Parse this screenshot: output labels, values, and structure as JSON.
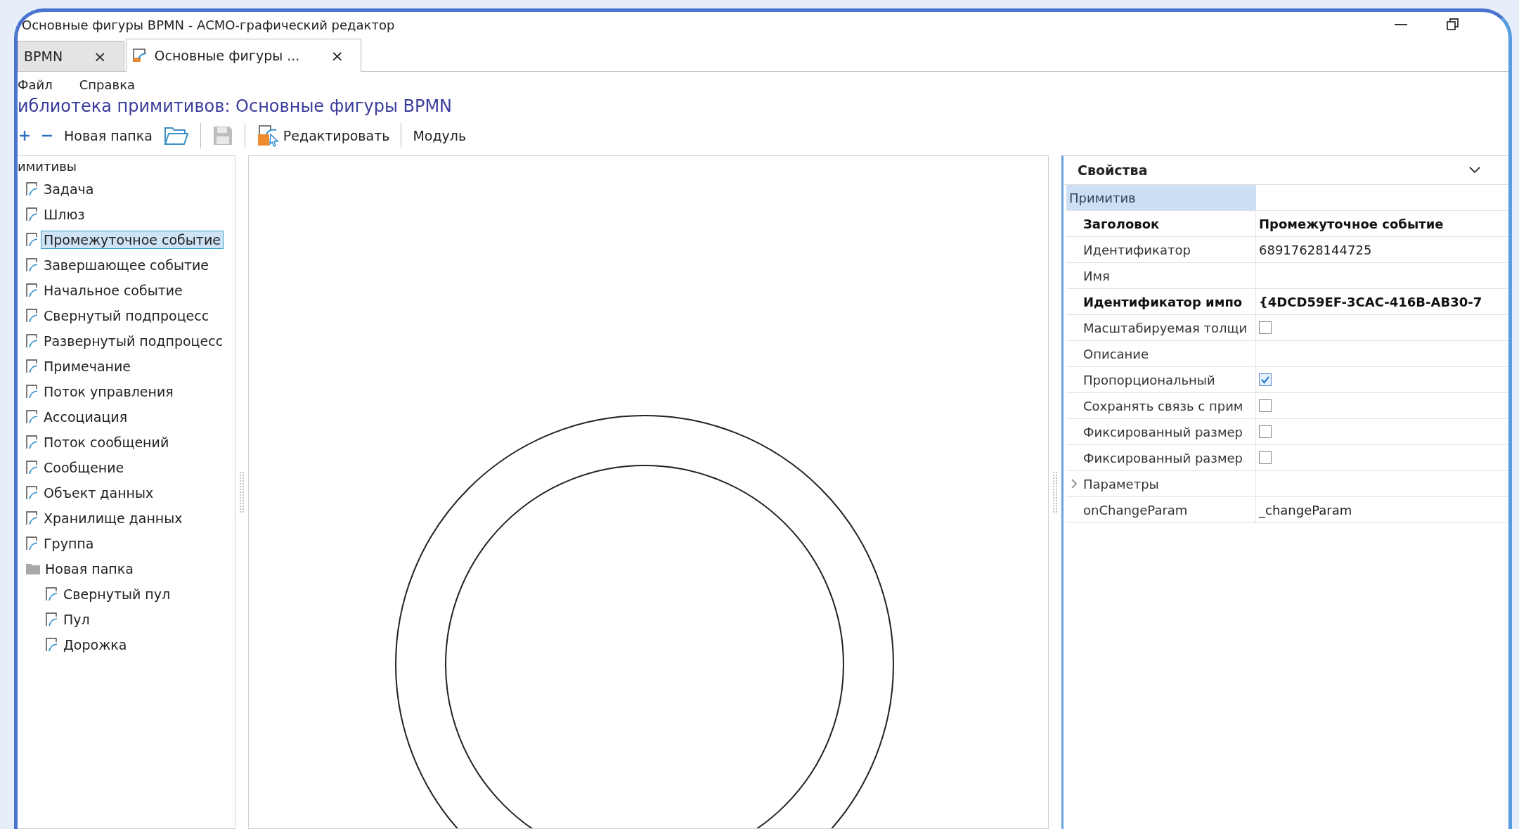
{
  "window": {
    "title": "Основные фигуры BPMN - АСМО-графический редактор"
  },
  "tabs": [
    {
      "label": "BPMN",
      "close": "×",
      "selected": false
    },
    {
      "label": "Основные фигуры ...",
      "close": "×",
      "selected": true
    }
  ],
  "menu": [
    "Файл",
    "Справка"
  ],
  "library_title": "иблиотека примитивов: Основные фигуры BPMN",
  "toolbar": {
    "new_folder": "Новая папка",
    "edit": "Редактировать",
    "module": "Модуль"
  },
  "tree": {
    "header": "имитивы",
    "items": [
      {
        "label": "Задача",
        "kind": "primitive",
        "selected": false
      },
      {
        "label": "Шлюз",
        "kind": "primitive",
        "selected": false
      },
      {
        "label": "Промежуточное событие",
        "kind": "primitive",
        "selected": true
      },
      {
        "label": "Завершающее событие",
        "kind": "primitive",
        "selected": false
      },
      {
        "label": "Начальное событие",
        "kind": "primitive",
        "selected": false
      },
      {
        "label": "Свернутый подпроцесс",
        "kind": "primitive",
        "selected": false
      },
      {
        "label": "Развернутый подпроцесс",
        "kind": "primitive",
        "selected": false
      },
      {
        "label": "Примечание",
        "kind": "primitive",
        "selected": false
      },
      {
        "label": "Поток управления",
        "kind": "primitive",
        "selected": false
      },
      {
        "label": "Ассоциация",
        "kind": "primitive",
        "selected": false
      },
      {
        "label": "Поток сообщений",
        "kind": "primitive",
        "selected": false
      },
      {
        "label": "Сообщение",
        "kind": "primitive",
        "selected": false
      },
      {
        "label": "Объект данных",
        "kind": "primitive",
        "selected": false
      },
      {
        "label": "Хранилище данных",
        "kind": "primitive",
        "selected": false
      },
      {
        "label": "Группа",
        "kind": "primitive",
        "selected": false
      },
      {
        "label": "Новая папка",
        "kind": "folder",
        "selected": false,
        "children": [
          {
            "label": "Свернутый пул",
            "kind": "primitive",
            "selected": false
          },
          {
            "label": "Пул",
            "kind": "primitive",
            "selected": false
          },
          {
            "label": "Дорожка",
            "kind": "primitive",
            "selected": false
          }
        ]
      }
    ]
  },
  "properties": {
    "title": "Свойства",
    "category": "Примитив",
    "rows": [
      {
        "name": "Заголовок",
        "kind": "text",
        "bold": true,
        "value": "Промежуточное событие"
      },
      {
        "name": "Идентификатор",
        "kind": "text",
        "bold": false,
        "value": "68917628144725"
      },
      {
        "name": "Имя",
        "kind": "text",
        "bold": false
      },
      {
        "name": "Идентификатор импо",
        "kind": "text",
        "bold": true,
        "value": "{4DCD59EF-3CAC-416B-AB30-7"
      },
      {
        "name": "Масштабируемая толщи",
        "kind": "check",
        "bold": false,
        "checked": false
      },
      {
        "name": "Описание",
        "kind": "text",
        "bold": false
      },
      {
        "name": "Пропорциональный",
        "kind": "check",
        "bold": false,
        "checked": true
      },
      {
        "name": "Сохранять связь с прим",
        "kind": "check",
        "bold": false,
        "checked": false
      },
      {
        "name": "Фиксированный размер",
        "kind": "check",
        "bold": false,
        "checked": false
      },
      {
        "name": "Фиксированный размер",
        "kind": "check",
        "bold": false,
        "checked": false
      },
      {
        "name": "Параметры",
        "kind": "group",
        "bold": false,
        "expanded": false
      },
      {
        "name": "onChangeParam",
        "kind": "text",
        "bold": false,
        "value": "_changeParam"
      }
    ]
  }
}
